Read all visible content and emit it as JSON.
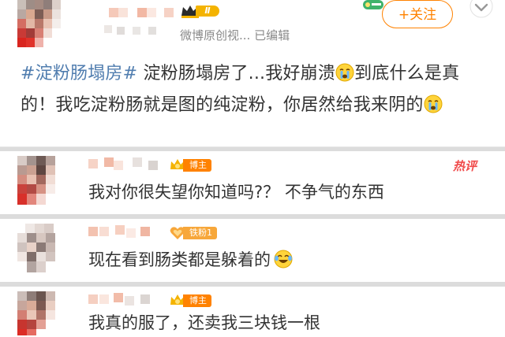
{
  "post": {
    "badge_level": "Ⅱ",
    "source": "微博原创视... 已编辑",
    "follow_label": "+关注",
    "hashtag": "#淀粉肠塌房#",
    "text_segments": [
      " 淀粉肠塌房了...我好崩溃",
      "到底什么是真的！我吃淀粉肠就是图的纯淀粉，你居然给我来阴的"
    ]
  },
  "comments": [
    {
      "badge": "博主",
      "hot_label": "热评",
      "text": "我对你很失望你知道吗?？ 不争气的东西"
    },
    {
      "badge": "铁粉1",
      "text": "现在看到肠类都是躲着的"
    },
    {
      "badge": "博主",
      "text": "我真的服了，还卖我三块钱一根"
    }
  ],
  "colors": {
    "accent": "#ff8200",
    "link": "#507daf",
    "hot": "#f04b4b",
    "text": "#333333",
    "meta": "#8a8a8a"
  },
  "icons": {
    "crying": "crying-emoji-icon",
    "laughing": "laughing-crying-emoji-icon",
    "crown": "crown-icon",
    "fan": "fan-heart-icon"
  }
}
